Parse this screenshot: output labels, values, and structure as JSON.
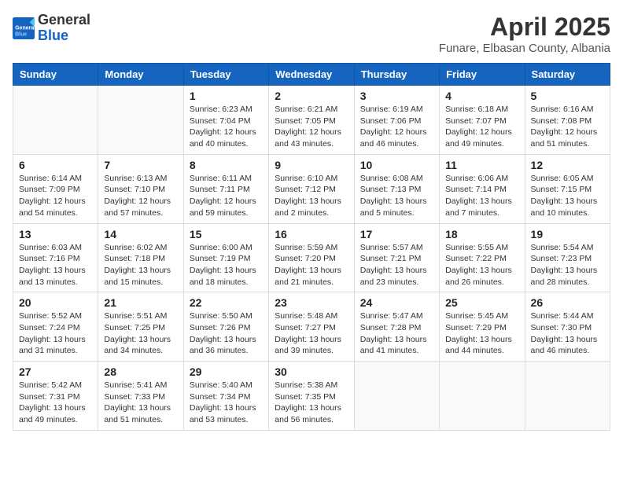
{
  "header": {
    "logo_general": "General",
    "logo_blue": "Blue",
    "month": "April 2025",
    "location": "Funare, Elbasan County, Albania"
  },
  "days_of_week": [
    "Sunday",
    "Monday",
    "Tuesday",
    "Wednesday",
    "Thursday",
    "Friday",
    "Saturday"
  ],
  "weeks": [
    [
      {
        "day": "",
        "info": ""
      },
      {
        "day": "",
        "info": ""
      },
      {
        "day": "1",
        "info": "Sunrise: 6:23 AM\nSunset: 7:04 PM\nDaylight: 12 hours and 40 minutes."
      },
      {
        "day": "2",
        "info": "Sunrise: 6:21 AM\nSunset: 7:05 PM\nDaylight: 12 hours and 43 minutes."
      },
      {
        "day": "3",
        "info": "Sunrise: 6:19 AM\nSunset: 7:06 PM\nDaylight: 12 hours and 46 minutes."
      },
      {
        "day": "4",
        "info": "Sunrise: 6:18 AM\nSunset: 7:07 PM\nDaylight: 12 hours and 49 minutes."
      },
      {
        "day": "5",
        "info": "Sunrise: 6:16 AM\nSunset: 7:08 PM\nDaylight: 12 hours and 51 minutes."
      }
    ],
    [
      {
        "day": "6",
        "info": "Sunrise: 6:14 AM\nSunset: 7:09 PM\nDaylight: 12 hours and 54 minutes."
      },
      {
        "day": "7",
        "info": "Sunrise: 6:13 AM\nSunset: 7:10 PM\nDaylight: 12 hours and 57 minutes."
      },
      {
        "day": "8",
        "info": "Sunrise: 6:11 AM\nSunset: 7:11 PM\nDaylight: 12 hours and 59 minutes."
      },
      {
        "day": "9",
        "info": "Sunrise: 6:10 AM\nSunset: 7:12 PM\nDaylight: 13 hours and 2 minutes."
      },
      {
        "day": "10",
        "info": "Sunrise: 6:08 AM\nSunset: 7:13 PM\nDaylight: 13 hours and 5 minutes."
      },
      {
        "day": "11",
        "info": "Sunrise: 6:06 AM\nSunset: 7:14 PM\nDaylight: 13 hours and 7 minutes."
      },
      {
        "day": "12",
        "info": "Sunrise: 6:05 AM\nSunset: 7:15 PM\nDaylight: 13 hours and 10 minutes."
      }
    ],
    [
      {
        "day": "13",
        "info": "Sunrise: 6:03 AM\nSunset: 7:16 PM\nDaylight: 13 hours and 13 minutes."
      },
      {
        "day": "14",
        "info": "Sunrise: 6:02 AM\nSunset: 7:18 PM\nDaylight: 13 hours and 15 minutes."
      },
      {
        "day": "15",
        "info": "Sunrise: 6:00 AM\nSunset: 7:19 PM\nDaylight: 13 hours and 18 minutes."
      },
      {
        "day": "16",
        "info": "Sunrise: 5:59 AM\nSunset: 7:20 PM\nDaylight: 13 hours and 21 minutes."
      },
      {
        "day": "17",
        "info": "Sunrise: 5:57 AM\nSunset: 7:21 PM\nDaylight: 13 hours and 23 minutes."
      },
      {
        "day": "18",
        "info": "Sunrise: 5:55 AM\nSunset: 7:22 PM\nDaylight: 13 hours and 26 minutes."
      },
      {
        "day": "19",
        "info": "Sunrise: 5:54 AM\nSunset: 7:23 PM\nDaylight: 13 hours and 28 minutes."
      }
    ],
    [
      {
        "day": "20",
        "info": "Sunrise: 5:52 AM\nSunset: 7:24 PM\nDaylight: 13 hours and 31 minutes."
      },
      {
        "day": "21",
        "info": "Sunrise: 5:51 AM\nSunset: 7:25 PM\nDaylight: 13 hours and 34 minutes."
      },
      {
        "day": "22",
        "info": "Sunrise: 5:50 AM\nSunset: 7:26 PM\nDaylight: 13 hours and 36 minutes."
      },
      {
        "day": "23",
        "info": "Sunrise: 5:48 AM\nSunset: 7:27 PM\nDaylight: 13 hours and 39 minutes."
      },
      {
        "day": "24",
        "info": "Sunrise: 5:47 AM\nSunset: 7:28 PM\nDaylight: 13 hours and 41 minutes."
      },
      {
        "day": "25",
        "info": "Sunrise: 5:45 AM\nSunset: 7:29 PM\nDaylight: 13 hours and 44 minutes."
      },
      {
        "day": "26",
        "info": "Sunrise: 5:44 AM\nSunset: 7:30 PM\nDaylight: 13 hours and 46 minutes."
      }
    ],
    [
      {
        "day": "27",
        "info": "Sunrise: 5:42 AM\nSunset: 7:31 PM\nDaylight: 13 hours and 49 minutes."
      },
      {
        "day": "28",
        "info": "Sunrise: 5:41 AM\nSunset: 7:33 PM\nDaylight: 13 hours and 51 minutes."
      },
      {
        "day": "29",
        "info": "Sunrise: 5:40 AM\nSunset: 7:34 PM\nDaylight: 13 hours and 53 minutes."
      },
      {
        "day": "30",
        "info": "Sunrise: 5:38 AM\nSunset: 7:35 PM\nDaylight: 13 hours and 56 minutes."
      },
      {
        "day": "",
        "info": ""
      },
      {
        "day": "",
        "info": ""
      },
      {
        "day": "",
        "info": ""
      }
    ]
  ]
}
